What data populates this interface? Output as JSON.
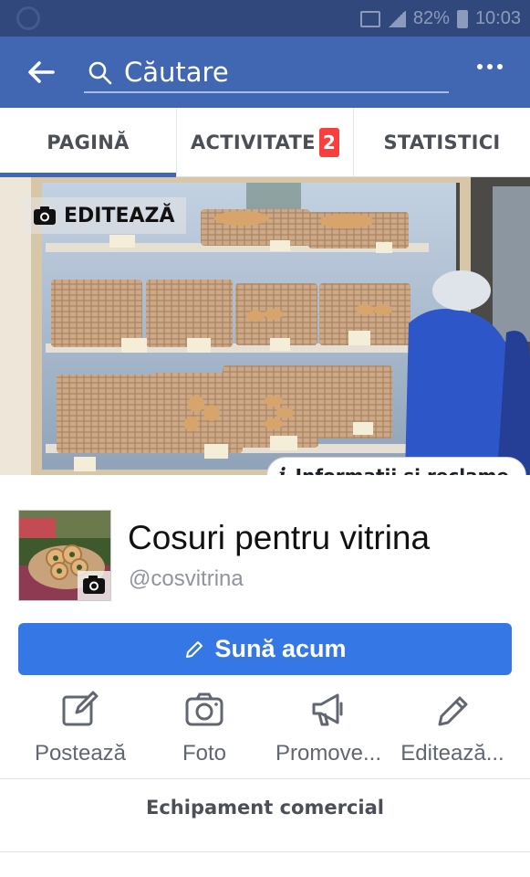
{
  "status_bar": {
    "battery": "82%",
    "time": "10:03"
  },
  "search": {
    "placeholder": "Căutare"
  },
  "tabs": [
    {
      "label": "PAGINĂ",
      "active": true
    },
    {
      "label": "ACTIVITATE",
      "badge": "2"
    },
    {
      "label": "STATISTICI"
    }
  ],
  "cover": {
    "edit_label": "EDITEAZĂ",
    "info_ads_label": "Informatii si reclame"
  },
  "page": {
    "name": "Cosuri pentru vitrina",
    "handle": "@cosvitrina"
  },
  "call_button": {
    "label": "Sună acum"
  },
  "actions": [
    {
      "label": "Postează",
      "icon": "compose-icon"
    },
    {
      "label": "Foto",
      "icon": "camera-icon"
    },
    {
      "label": "Promove...",
      "icon": "megaphone-icon"
    },
    {
      "label": "Editează...",
      "icon": "pencil-icon"
    }
  ],
  "category": "Echipament comercial",
  "colors": {
    "brand": "#4267b2",
    "button": "#3578e5",
    "badge": "#fa3e3e"
  }
}
